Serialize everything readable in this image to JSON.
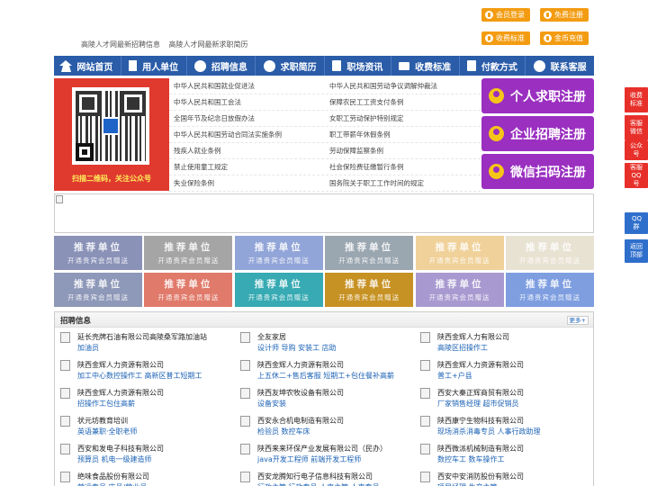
{
  "header": {
    "links": [
      "高陵人才网最新招聘信息",
      "高陵人才网最新求职简历"
    ],
    "buttons": [
      {
        "label": "会员登录"
      },
      {
        "label": "免费注册"
      },
      {
        "label": "收费标准"
      },
      {
        "label": "金币充值"
      }
    ]
  },
  "nav": {
    "items": [
      {
        "label": "网站首页",
        "icon": "house-icon"
      },
      {
        "label": "用人单位",
        "icon": "building-icon"
      },
      {
        "label": "招聘信息",
        "icon": "megaphone-icon"
      },
      {
        "label": "求职简历",
        "icon": "search-icon"
      },
      {
        "label": "职场资讯",
        "icon": "news-icon"
      },
      {
        "label": "收费标准",
        "icon": "cart-icon"
      },
      {
        "label": "付款方式",
        "icon": "card-icon"
      },
      {
        "label": "联系客服",
        "icon": "phone-icon"
      }
    ]
  },
  "qr": {
    "caption": "扫描二维码，关注公众号"
  },
  "laws": [
    [
      "中华人民共和国就业促进法",
      "中华人民共和国劳动争议调解仲裁法"
    ],
    [
      "中华人民共和国工会法",
      "保障农民工工资支付条例"
    ],
    [
      "全国年节及纪念日放假办法",
      "女职工劳动保护特别规定"
    ],
    [
      "中华人民共和国劳动合同法实施条例",
      "职工带薪年休假条例"
    ],
    [
      "残疾人就业条例",
      "劳动保障监察条例"
    ],
    [
      "禁止使用童工规定",
      "社会保险费征缴暂行条例"
    ],
    [
      "失业保险条例",
      "国务院关于职工工作时间的规定"
    ]
  ],
  "register": [
    {
      "label": "个人求职注册"
    },
    {
      "label": "企业招聘注册"
    },
    {
      "label": "微信扫码注册"
    }
  ],
  "units": {
    "title": "推荐单位",
    "subtitle": "开通贵宾会员赠送",
    "colors": [
      "#8a92b8",
      "#a5a5a5",
      "#92a5d8",
      "#9aa6b0",
      "#f0d19a",
      "#e8e2d2",
      "#8e98b8",
      "#e07a6a",
      "#37aab3",
      "#c79224",
      "#a89ad0",
      "#7e9ee0"
    ]
  },
  "jobs": {
    "title": "招聘信息",
    "more": "更多+",
    "items": [
      {
        "company": "延长壳牌石油有限公司高陵桑军路加油站",
        "positions": "加油员"
      },
      {
        "company": "全友家居",
        "positions": "设计师 导购 安装工 店助"
      },
      {
        "company": "陕西金辉人力有限公司",
        "positions": "高陵区招操作工"
      },
      {
        "company": "陕西金辉人力资源有限公司",
        "positions": "加工中心数控操作工 高新区普工短期工"
      },
      {
        "company": "陕西金辉人力资源有限公司",
        "positions": "上五休二+售后客服 短期工+包住餐补高薪"
      },
      {
        "company": "陕西金辉人力资源有限公司",
        "positions": "普工+户县"
      },
      {
        "company": "陕西金辉人力资源有限公司",
        "positions": "招操作工包住高薪"
      },
      {
        "company": "陕西友坤农牧设备有限公司",
        "positions": "设备安装"
      },
      {
        "company": "西安大秦正辉商贸有限公司",
        "positions": "厂家销售经理 超市促销员"
      },
      {
        "company": "状元坊教育培训",
        "positions": "英语兼职·全职老师"
      },
      {
        "company": "西安永合机电制造有限公司",
        "positions": "检验员 数控车床"
      },
      {
        "company": "陕西康宁生物科技有限公司",
        "positions": "现场消杀消毒专员 人事行政助理"
      },
      {
        "company": "西安和发电子科技有限公司",
        "positions": "预算员 机电一级建造师"
      },
      {
        "company": "陕西来来环保产业发展有限公司（民办）",
        "positions": "java开发工程师 前端开发工程师"
      },
      {
        "company": "陕西微派机械制造有限公司",
        "positions": "数控车工 数车操作工"
      },
      {
        "company": "绝味食品股份有限公司",
        "positions": "营运专员 店员/营业员"
      },
      {
        "company": "西安龙腾知行电子信息科技有限公司",
        "positions": "行政主管 行政专员 人事主管 人事专员"
      },
      {
        "company": "西安中安消防股份有限公司",
        "positions": "项目经理 生产主管"
      }
    ]
  },
  "side": [
    {
      "label": "收费标准"
    },
    {
      "label": "客服微信"
    },
    {
      "label": "公众号"
    },
    {
      "label": "客服QQ号"
    },
    {
      "label": "QQ群"
    },
    {
      "label": "返回顶部"
    }
  ]
}
